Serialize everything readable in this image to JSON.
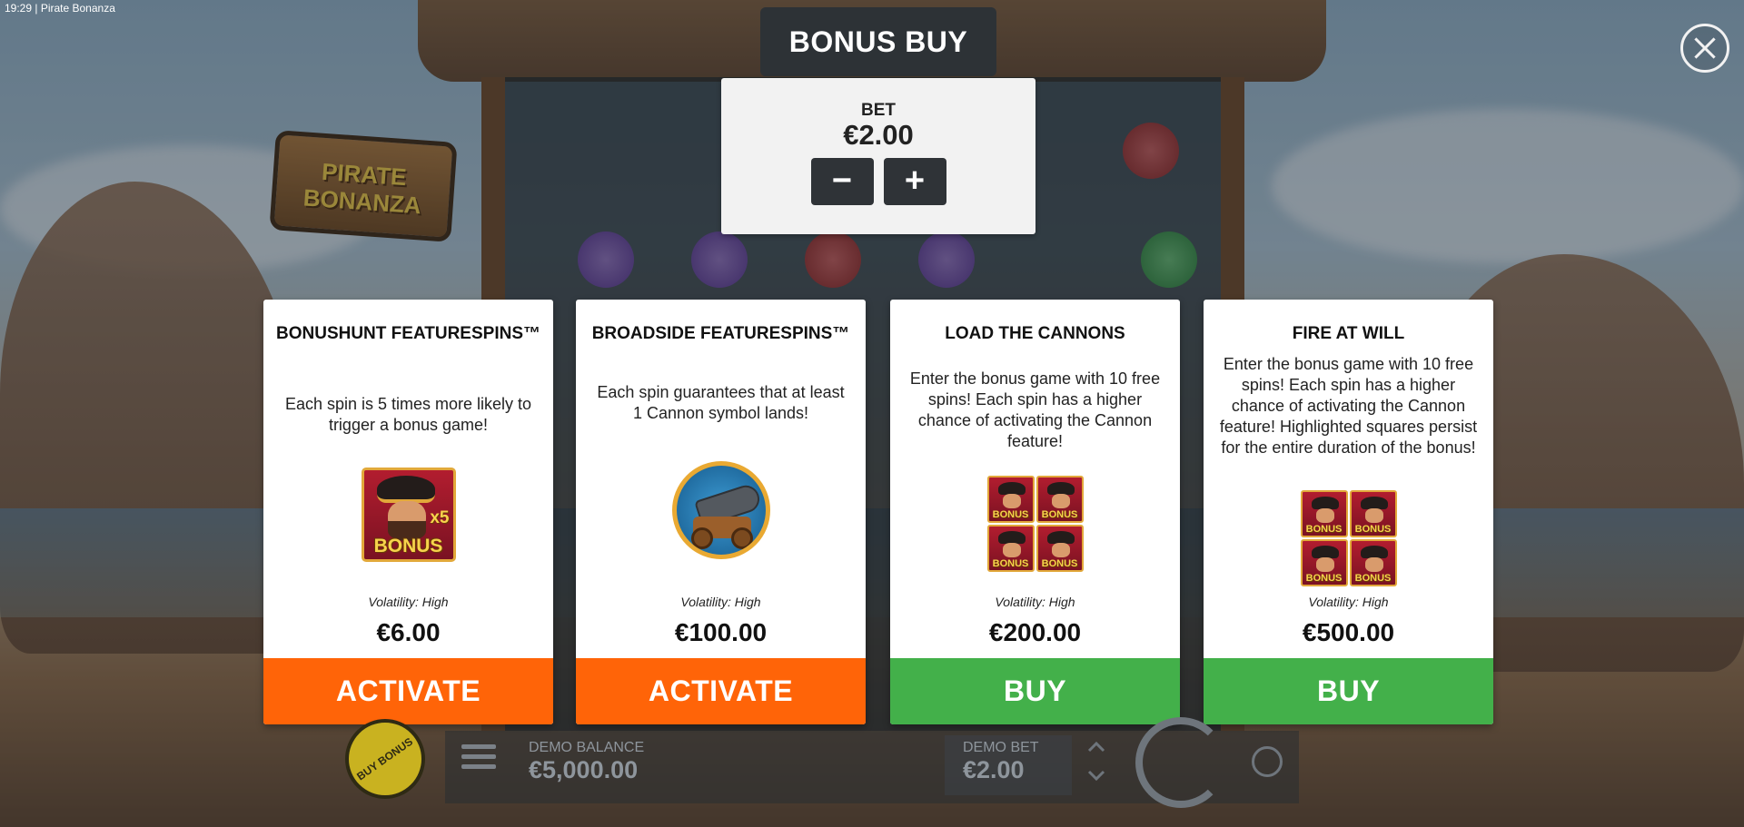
{
  "status_bar": {
    "time": "19:29",
    "app_title": "| Pirate Bonanza"
  },
  "background": {
    "logo_text": "PIRATE BONANZA"
  },
  "modal": {
    "title": "BONUS BUY",
    "bet": {
      "label": "BET",
      "value": "€2.00",
      "decrease_label": "−",
      "increase_label": "+"
    },
    "options": [
      {
        "title": "BONUSHUNT FEATURESPINS™",
        "description": "Each spin is 5 times more likely to trigger a bonus game!",
        "image": "pirate-bonus-x5-icon",
        "image_texts": [
          "x5",
          "BONUS"
        ],
        "volatility": "Volatility: High",
        "price": "€6.00",
        "action": "ACTIVATE",
        "action_color": "#ff6408"
      },
      {
        "title": "BROADSIDE FEATURESPINS™",
        "description": "Each spin guarantees that at least 1 Cannon symbol lands!",
        "image": "cannon-icon",
        "volatility": "Volatility: High",
        "price": "€100.00",
        "action": "ACTIVATE",
        "action_color": "#ff6408"
      },
      {
        "title": "LOAD THE CANNONS",
        "description": "Enter the bonus game with 10 free spins! Each spin has a higher chance of activating the Cannon feature!",
        "image": "four-bonus-scatter-icon",
        "image_texts": [
          "BONUS",
          "BONUS",
          "BONUS",
          "BONUS"
        ],
        "volatility": "Volatility: High",
        "price": "€200.00",
        "action": "BUY",
        "action_color": "#43b04a"
      },
      {
        "title": "FIRE AT WILL",
        "description": "Enter the bonus game with 10 free spins! Each spin has a higher chance of activating the Cannon feature! Highlighted squares persist for the entire duration of the bonus!",
        "image": "bonus-scatter-grid-icon",
        "image_texts": [
          "BONUS",
          "BONUS",
          "BONUS",
          "BONUS"
        ],
        "volatility": "Volatility: High",
        "price": "€500.00",
        "action": "BUY",
        "action_color": "#43b04a"
      }
    ]
  },
  "bottom_bar": {
    "buy_bonus_label": "BUY BONUS",
    "demo_balance_label": "DEMO BALANCE",
    "demo_balance_value": "€5,000.00",
    "demo_bet_label": "DEMO BET",
    "demo_bet_value": "€2.00"
  }
}
